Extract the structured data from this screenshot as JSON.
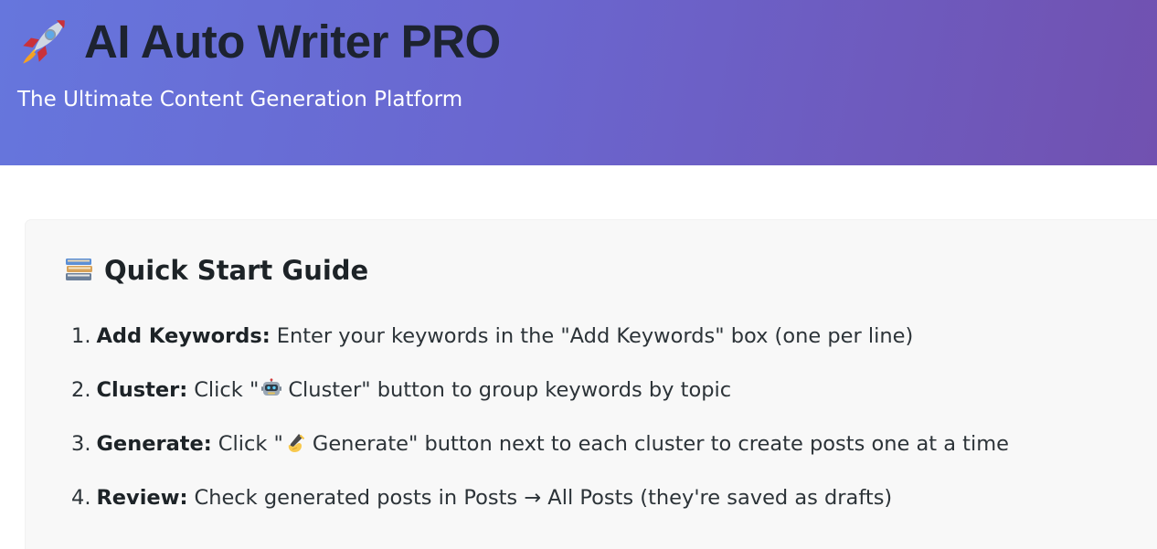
{
  "header": {
    "rocket_icon": "rocket-icon",
    "title": "AI Auto Writer PRO",
    "subtitle": "The Ultimate Content Generation Platform",
    "gradient_start": "#6676dd",
    "gradient_end": "#7151b0"
  },
  "guide": {
    "icon": "books-icon",
    "heading": "Quick Start Guide",
    "steps": [
      {
        "number": "1.",
        "label": "Add Keywords:",
        "text": "Enter your keywords in the \"Add Keywords\" box (one per line)"
      },
      {
        "number": "2.",
        "label": "Cluster:",
        "text_before": "Click \"",
        "icon": "robot-icon",
        "text_after": "Cluster\" button to group keywords by topic"
      },
      {
        "number": "3.",
        "label": "Generate:",
        "text_before": "Click \"",
        "icon": "writing-hand-icon",
        "text_after": "Generate\" button next to each cluster to create posts one at a time"
      },
      {
        "number": "4.",
        "label": "Review:",
        "text": "Check generated posts in Posts → All Posts (they're saved as drafts)"
      }
    ]
  }
}
